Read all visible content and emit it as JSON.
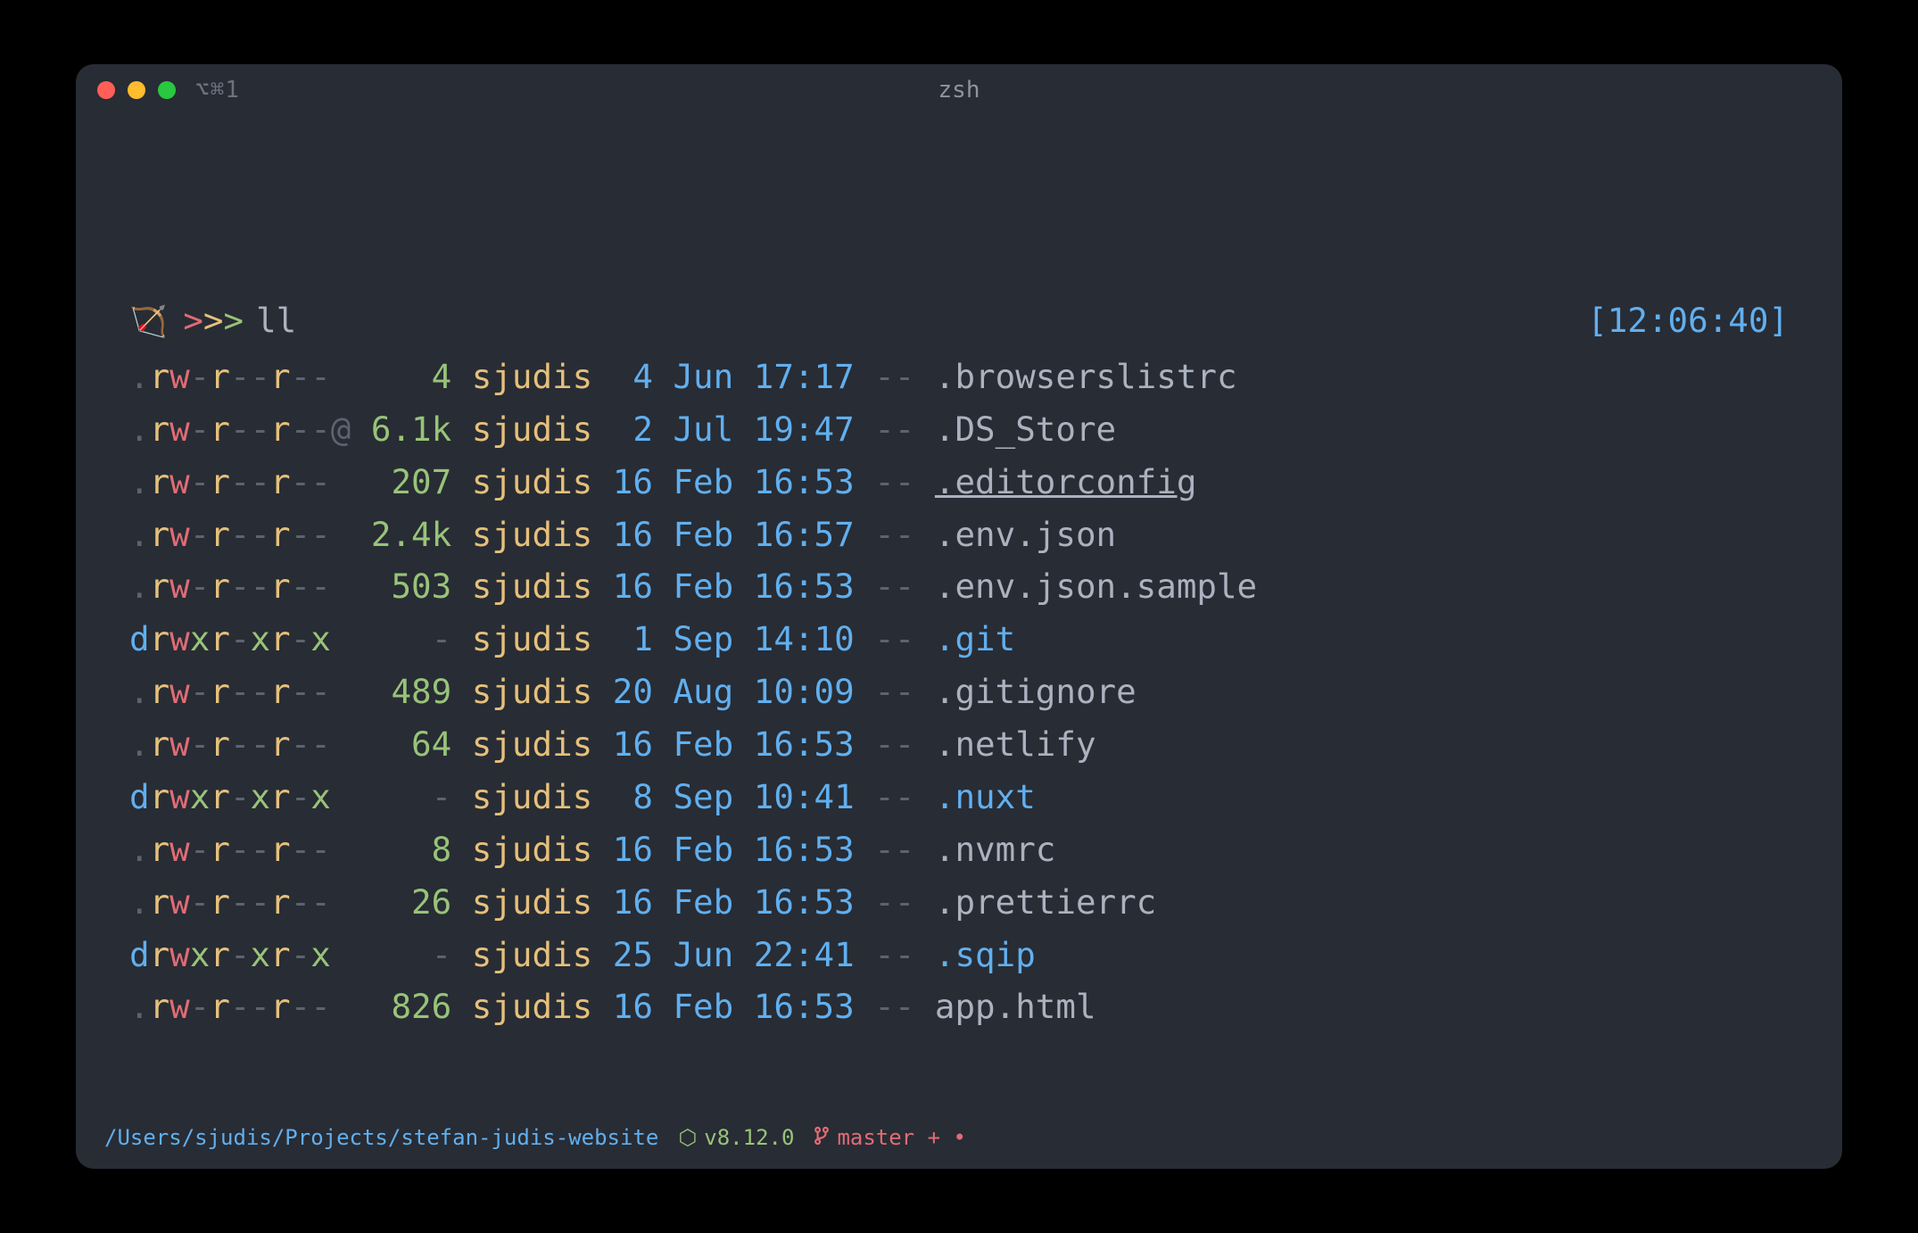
{
  "window": {
    "tab_label": "⌥⌘1",
    "title": "zsh"
  },
  "prompt": {
    "icon": "🏹",
    "chevrons": ">>>",
    "command": "ll",
    "timestamp": "[12:06:40]"
  },
  "listing": {
    "user": "sjudis",
    "dashmark": "--",
    "rows": [
      {
        "perm": ".rw-r--r--",
        "xattr": " ",
        "size": "4",
        "day": "4",
        "mon": "Jun",
        "time": "17:17",
        "name": ".browserslistrc",
        "dir": false,
        "link": false
      },
      {
        "perm": ".rw-r--r--",
        "xattr": "@",
        "size": "6.1k",
        "day": "2",
        "mon": "Jul",
        "time": "19:47",
        "name": ".DS_Store",
        "dir": false,
        "link": false
      },
      {
        "perm": ".rw-r--r--",
        "xattr": " ",
        "size": "207",
        "day": "16",
        "mon": "Feb",
        "time": "16:53",
        "name": ".editorconfig",
        "dir": false,
        "link": true
      },
      {
        "perm": ".rw-r--r--",
        "xattr": " ",
        "size": "2.4k",
        "day": "16",
        "mon": "Feb",
        "time": "16:57",
        "name": ".env.json",
        "dir": false,
        "link": false
      },
      {
        "perm": ".rw-r--r--",
        "xattr": " ",
        "size": "503",
        "day": "16",
        "mon": "Feb",
        "time": "16:53",
        "name": ".env.json.sample",
        "dir": false,
        "link": false
      },
      {
        "perm": "drwxr-xr-x",
        "xattr": " ",
        "size": "-",
        "day": "1",
        "mon": "Sep",
        "time": "14:10",
        "name": ".git",
        "dir": true,
        "link": false
      },
      {
        "perm": ".rw-r--r--",
        "xattr": " ",
        "size": "489",
        "day": "20",
        "mon": "Aug",
        "time": "10:09",
        "name": ".gitignore",
        "dir": false,
        "link": false
      },
      {
        "perm": ".rw-r--r--",
        "xattr": " ",
        "size": "64",
        "day": "16",
        "mon": "Feb",
        "time": "16:53",
        "name": ".netlify",
        "dir": false,
        "link": false
      },
      {
        "perm": "drwxr-xr-x",
        "xattr": " ",
        "size": "-",
        "day": "8",
        "mon": "Sep",
        "time": "10:41",
        "name": ".nuxt",
        "dir": true,
        "link": false
      },
      {
        "perm": ".rw-r--r--",
        "xattr": " ",
        "size": "8",
        "day": "16",
        "mon": "Feb",
        "time": "16:53",
        "name": ".nvmrc",
        "dir": false,
        "link": false
      },
      {
        "perm": ".rw-r--r--",
        "xattr": " ",
        "size": "26",
        "day": "16",
        "mon": "Feb",
        "time": "16:53",
        "name": ".prettierrc",
        "dir": false,
        "link": false
      },
      {
        "perm": "drwxr-xr-x",
        "xattr": " ",
        "size": "-",
        "day": "25",
        "mon": "Jun",
        "time": "22:41",
        "name": ".sqip",
        "dir": true,
        "link": false
      },
      {
        "perm": ".rw-r--r--",
        "xattr": " ",
        "size": "826",
        "day": "16",
        "mon": "Feb",
        "time": "16:53",
        "name": "app.html",
        "dir": false,
        "link": false
      }
    ]
  },
  "status": {
    "path": "/Users/sjudis/Projects/stefan-judis-website",
    "node_version": "v8.12.0",
    "git_branch": "master + •"
  }
}
